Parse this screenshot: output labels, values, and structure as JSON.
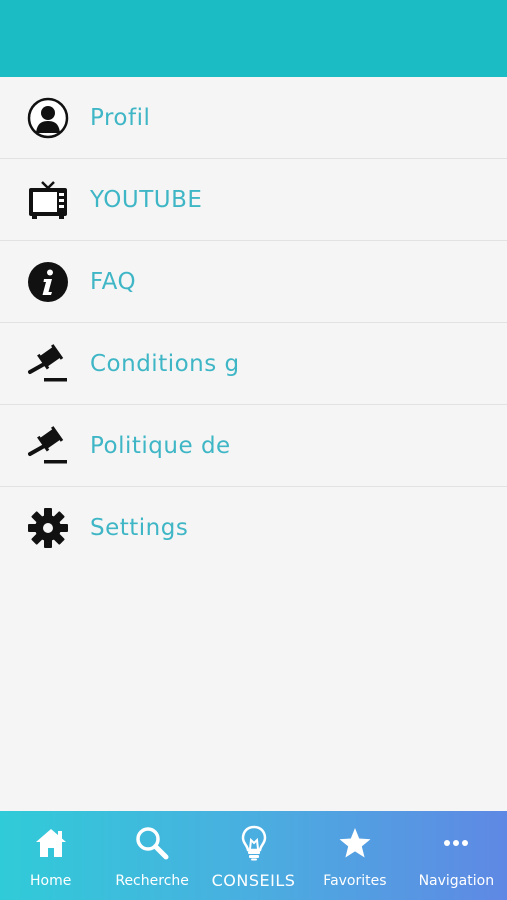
{
  "header": {
    "color": "#1bbcc4"
  },
  "menu": {
    "label_color": "#3fb6c6",
    "items": [
      {
        "label": "Profil",
        "icon": "person-icon"
      },
      {
        "label": "YOUTUBE",
        "icon": "tv-icon"
      },
      {
        "label": "FAQ",
        "icon": "info-icon"
      },
      {
        "label": "Conditions g",
        "icon": "gavel-icon"
      },
      {
        "label": "Politique de",
        "icon": "gavel-icon"
      },
      {
        "label": "Settings",
        "icon": "gear-icon"
      }
    ]
  },
  "tabbar": {
    "gradient": [
      "#30cbd8",
      "#5f88e4"
    ],
    "tabs": [
      {
        "label": "Home",
        "icon": "home-icon"
      },
      {
        "label": "Recherche",
        "icon": "search-icon"
      },
      {
        "label": "CONSEILS",
        "icon": "lightbulb-icon",
        "active": true
      },
      {
        "label": "Favorites",
        "icon": "star-icon"
      },
      {
        "label": "Navigation",
        "icon": "more-icon"
      }
    ]
  }
}
